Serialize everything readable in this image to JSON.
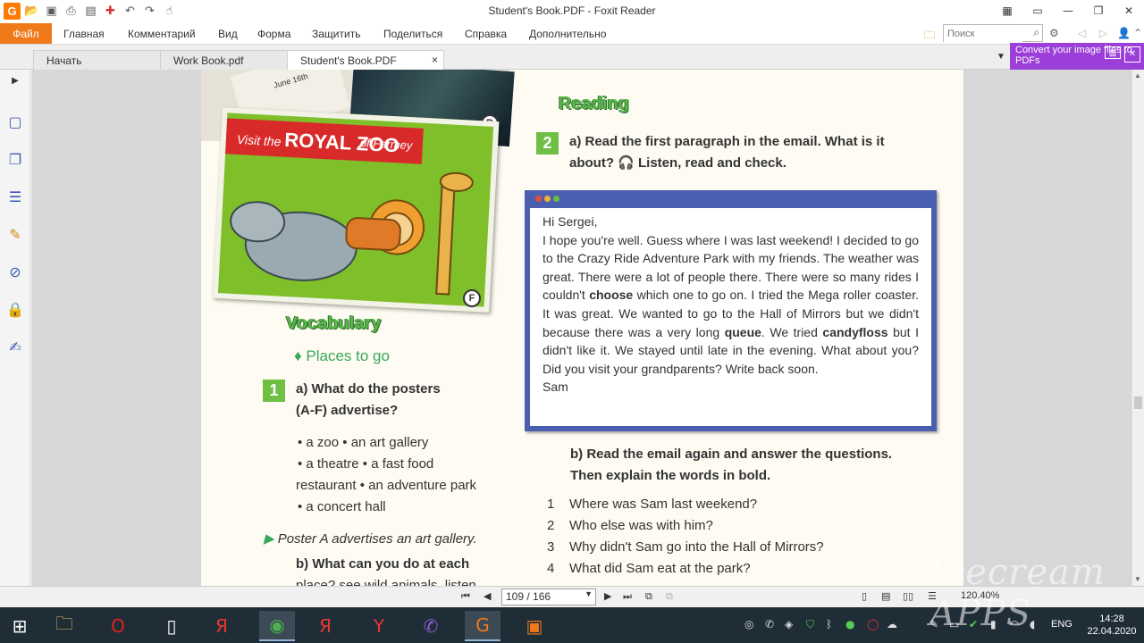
{
  "window": {
    "title": "Student's Book.PDF - Foxit Reader"
  },
  "quick_access": {
    "icons": [
      "app-logo",
      "open-icon",
      "save-icon",
      "print-icon",
      "properties-icon",
      "create-icon",
      "undo-icon",
      "redo-icon",
      "hand-tool-icon"
    ]
  },
  "ribbon": {
    "file_tab": "Файл",
    "tabs": [
      "Главная",
      "Комментарий",
      "Вид",
      "Форма",
      "Защитить",
      "Поделиться",
      "Справка",
      "Дополнительно"
    ],
    "search_placeholder": "Поиск"
  },
  "doc_tabs": [
    {
      "label": "Начать"
    },
    {
      "label": "Work Book.pdf"
    },
    {
      "label": "Student's Book.PDF",
      "close": "×"
    }
  ],
  "promo": {
    "text": "Convert your image files to PDFs"
  },
  "page": {
    "poster_f": {
      "banner_pre": "Visit the",
      "banner_brand": "ROYAL ZOO",
      "banner_post": "of Farmey",
      "badge": "F"
    },
    "ticket_text": "June 16th",
    "poster_b_badge": "B",
    "reading_heading": "Reading",
    "reading_num": "2",
    "reading_q_line1": "a)  Read the first paragraph in the email. What is it",
    "reading_q_line2": "about? 🎧 Listen, read and check.",
    "email": {
      "greeting": "Hi Sergei,",
      "body_1": "I hope you're well. Guess where I was last weekend! I decided to go to the Crazy Ride Adventure Park with my friends. The weather was great. There were a lot of people there. There were so many rides I couldn't ",
      "bold_choose": "choose",
      "body_2": " which one to go on. I tried the Mega roller coaster. It was great. We wanted to go to the Hall of Mirrors but we didn't because there was a very long ",
      "bold_queue": "queue",
      "body_3": ". We tried ",
      "bold_candyfloss": "candyfloss",
      "body_4": " but I didn't like it. We stayed until late in the evening. What about you? Did you visit your grandparents? Write back soon.",
      "signoff": "Sam"
    },
    "b_line1": "b)  Read the email again and answer the questions.",
    "b_line2": "Then explain the words in bold.",
    "questions": [
      {
        "n": "1",
        "text": "Where was Sam last weekend?"
      },
      {
        "n": "2",
        "text": "Who else was with him?"
      },
      {
        "n": "3",
        "text": "Why didn't Sam go into the Hall of Mirrors?"
      },
      {
        "n": "4",
        "text": "What did Sam eat at the park?"
      }
    ],
    "vocab_heading": "Vocabulary",
    "places_heading": "♦  Places to go",
    "vocab_num": "1",
    "vocab_q_line1": "a)  What do the posters",
    "vocab_q_line2": "(A-F) advertise?",
    "vocab_list_lines": [
      "• a zoo   • an art gallery",
      "• a theatre   • a fast food",
      "restaurant   • an adventure park",
      "• a concert hall"
    ],
    "example": "Poster A advertises an art gallery.",
    "vocab_b": "b)  What can you do at each",
    "vocab_b_cut": "place? see wild animals, listen"
  },
  "doc_nav": {
    "page_field": "109 / 166",
    "zoom": "120.40%"
  },
  "taskbar": {
    "lang": "ENG",
    "time": "14:28",
    "date": "22.04.2020"
  },
  "watermark": "Icecream APPS"
}
